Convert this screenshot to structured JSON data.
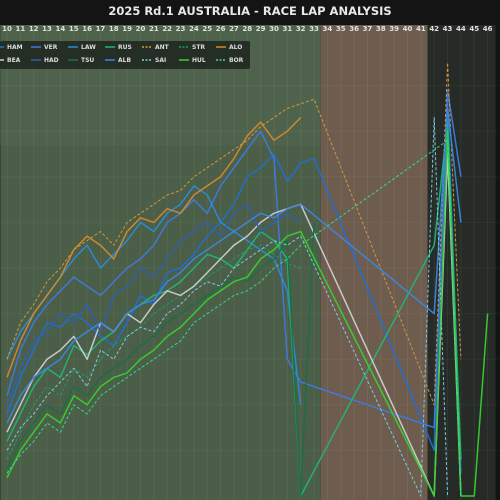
{
  "chart_data": {
    "type": "line",
    "title": "2025 Rd.1 AUSTRALIA - RACE LAP ANALYSIS",
    "xlabel": "",
    "ylabel": "",
    "x_ticks": [
      "10",
      "11",
      "12",
      "13",
      "14",
      "15",
      "16",
      "17",
      "18",
      "19",
      "20",
      "21",
      "22",
      "23",
      "24",
      "25",
      "26",
      "27",
      "28",
      "29",
      "30",
      "31",
      "32",
      "33",
      "34",
      "35",
      "36",
      "37",
      "38",
      "39",
      "40",
      "41",
      "42",
      "43",
      "44",
      "45",
      "46"
    ],
    "xlim": [
      10,
      46.6
    ],
    "ylim": [
      0,
      100
    ],
    "grid": true,
    "legend_position": "top-left",
    "phases": [
      {
        "from": 9.5,
        "to": 33.5,
        "color": "#4b5e47"
      },
      {
        "from": 33.5,
        "to": 41.5,
        "color": "#6e5d4f"
      },
      {
        "from": 41.5,
        "to": 46.6,
        "color": "#262b27"
      }
    ],
    "series": [
      {
        "name": "HAM",
        "color": "#1e6fd6",
        "dash": false,
        "x": [
          10,
          11,
          12,
          13,
          14,
          15,
          16,
          17,
          18,
          19,
          20,
          21,
          22,
          23,
          24,
          25,
          26,
          27,
          28,
          29,
          30,
          31,
          32,
          33,
          42,
          43,
          44
        ],
        "y": [
          18,
          26,
          32,
          38,
          37,
          40,
          38,
          35,
          33,
          38,
          44,
          42,
          49,
          50,
          53,
          57,
          60,
          64,
          70,
          72,
          75,
          69,
          73,
          74,
          10,
          87,
          5
        ]
      },
      {
        "name": "VER",
        "color": "#3e7ae0",
        "dash": false,
        "x": [
          10,
          11,
          12,
          13,
          14,
          15,
          16,
          17,
          18,
          19,
          20,
          21,
          22,
          23,
          24,
          25,
          26,
          27,
          28,
          29,
          30,
          31,
          32,
          42,
          43,
          44
        ],
        "y": [
          22,
          32,
          38,
          42,
          45,
          48,
          46,
          44,
          47,
          50,
          52,
          55,
          60,
          62,
          65,
          62,
          68,
          72,
          76,
          80,
          74,
          30,
          25,
          15,
          89,
          70
        ]
      },
      {
        "name": "LAW",
        "color": "#2b8cd8",
        "dash": false,
        "x": [
          10,
          11,
          12,
          13,
          14,
          15,
          16,
          17,
          18,
          19,
          20,
          21,
          22,
          23,
          24,
          25,
          26,
          27,
          28,
          29,
          30,
          31,
          32
        ],
        "y": [
          30,
          36,
          40,
          44,
          48,
          52,
          55,
          50,
          53,
          56,
          60,
          58,
          62,
          64,
          68,
          66,
          60,
          58,
          56,
          54,
          52,
          45,
          20
        ]
      },
      {
        "name": "RUS",
        "color": "#22b573",
        "dash": false,
        "x": [
          10,
          11,
          12,
          13,
          14,
          15,
          16,
          17,
          18,
          19,
          20,
          21,
          22,
          23,
          24,
          25,
          26,
          27,
          28,
          29,
          30,
          31,
          32,
          42,
          43,
          44
        ],
        "y": [
          12,
          18,
          24,
          28,
          26,
          33,
          31,
          34,
          36,
          40,
          42,
          44,
          45,
          47,
          50,
          53,
          52,
          50,
          54,
          58,
          56,
          52,
          0,
          55,
          82,
          8
        ]
      },
      {
        "name": "ANT",
        "color": "#d99a3b",
        "dash": true,
        "x": [
          10,
          11,
          12,
          13,
          14,
          15,
          16,
          17,
          18,
          19,
          20,
          21,
          22,
          23,
          24,
          25,
          26,
          27,
          28,
          29,
          30,
          31,
          32,
          33,
          42,
          43,
          44
        ],
        "y": [
          30,
          38,
          42,
          47,
          50,
          54,
          56,
          58,
          55,
          60,
          62,
          64,
          66,
          67,
          70,
          72,
          74,
          76,
          78,
          81,
          83,
          85,
          86,
          87,
          20,
          95,
          30
        ]
      },
      {
        "name": "STR",
        "color": "#1ba06b",
        "dash": true,
        "x": [
          10,
          11,
          12,
          13,
          14,
          15,
          16,
          17,
          18,
          19,
          20,
          21,
          22,
          23,
          24,
          25,
          26,
          27,
          28,
          29,
          30,
          31,
          32
        ],
        "y": [
          8,
          14,
          20,
          24,
          22,
          28,
          26,
          30,
          33,
          35,
          37,
          40,
          42,
          44,
          46,
          48,
          50,
          52,
          54,
          55,
          53,
          51,
          50
        ]
      },
      {
        "name": "ALO",
        "color": "#d48a2c",
        "dash": false,
        "x": [
          10,
          11,
          12,
          13,
          14,
          15,
          16,
          17,
          18,
          19,
          20,
          21,
          22,
          23,
          24,
          25,
          26,
          27,
          28,
          29,
          30,
          31,
          32
        ],
        "y": [
          26,
          34,
          40,
          44,
          48,
          54,
          57,
          55,
          52,
          58,
          61,
          60,
          63,
          62,
          66,
          68,
          70,
          74,
          79,
          82,
          78,
          80,
          83
        ]
      },
      {
        "name": "BEA",
        "color": "#cfcfcf",
        "dash": false,
        "x": [
          10,
          11,
          12,
          13,
          14,
          15,
          16,
          17,
          18,
          19,
          20,
          21,
          22,
          23,
          24,
          25,
          26,
          27,
          28,
          29,
          30,
          31,
          32,
          42,
          43,
          44
        ],
        "y": [
          14,
          20,
          26,
          30,
          32,
          35,
          30,
          38,
          36,
          40,
          38,
          42,
          45,
          44,
          46,
          49,
          52,
          55,
          57,
          60,
          62,
          63,
          64,
          0,
          75,
          0
        ]
      },
      {
        "name": "HAD",
        "color": "#2f5fb0",
        "dash": false,
        "x": [
          10,
          11,
          12,
          13,
          14,
          15,
          16,
          17,
          18,
          19,
          20,
          21,
          22,
          23,
          24,
          25,
          26,
          27,
          28,
          29,
          30,
          31,
          32
        ],
        "y": [
          20,
          28,
          34,
          36,
          40,
          38,
          42,
          36,
          44,
          46,
          50,
          48,
          52,
          56,
          58,
          60,
          57,
          62,
          64,
          58,
          60,
          62,
          60
        ]
      },
      {
        "name": "TSU",
        "color": "#1b6e47",
        "dash": false,
        "x": [
          10,
          11,
          12,
          13,
          14,
          15,
          16,
          17,
          18,
          19,
          20,
          21,
          22,
          23,
          24,
          25,
          26,
          27,
          28,
          29,
          30,
          31,
          32,
          33
        ],
        "y": [
          6,
          12,
          16,
          20,
          18,
          24,
          22,
          26,
          28,
          30,
          33,
          35,
          38,
          40,
          42,
          44,
          46,
          48,
          47,
          50,
          52,
          56,
          0,
          60
        ]
      },
      {
        "name": "ALB",
        "color": "#3b86e0",
        "dash": false,
        "x": [
          10,
          11,
          12,
          13,
          14,
          15,
          16,
          17,
          18,
          19,
          20,
          21,
          22,
          23,
          24,
          25,
          26,
          27,
          28,
          29,
          30,
          31,
          32,
          42,
          43,
          44
        ],
        "y": [
          16,
          22,
          26,
          28,
          30,
          34,
          36,
          38,
          36,
          40,
          42,
          43,
          47,
          49,
          52,
          54,
          56,
          58,
          60,
          62,
          61,
          63,
          64,
          40,
          85,
          60
        ]
      },
      {
        "name": "SAI",
        "color": "#7fd1e6",
        "dash": true,
        "x": [
          10,
          11,
          12,
          13,
          14,
          15,
          16,
          17,
          18,
          19,
          20,
          21,
          22,
          23,
          24,
          25,
          26,
          27,
          28,
          29,
          30,
          31,
          32,
          41,
          42,
          43
        ],
        "y": [
          10,
          15,
          18,
          22,
          25,
          28,
          24,
          32,
          30,
          35,
          37,
          36,
          40,
          42,
          45,
          47,
          46,
          50,
          52,
          54,
          56,
          55,
          57,
          0,
          83,
          0
        ]
      },
      {
        "name": "HUL",
        "color": "#36d12e",
        "dash": false,
        "x": [
          10,
          11,
          12,
          13,
          14,
          15,
          16,
          17,
          18,
          19,
          20,
          21,
          22,
          23,
          24,
          25,
          26,
          27,
          28,
          29,
          30,
          31,
          32,
          42,
          43,
          44,
          45,
          46
        ],
        "y": [
          4,
          10,
          14,
          18,
          16,
          22,
          20,
          24,
          26,
          27,
          30,
          32,
          35,
          37,
          40,
          43,
          45,
          47,
          48,
          52,
          54,
          57,
          58,
          0,
          80,
          0,
          0,
          40
        ]
      },
      {
        "name": "BOR",
        "color": "#33e08a",
        "dash": true,
        "x": [
          10,
          11,
          12,
          13,
          14,
          15,
          16,
          17,
          18,
          19,
          20,
          21,
          22,
          23,
          24,
          25,
          26,
          27,
          28,
          29,
          30,
          31,
          32,
          43,
          44
        ],
        "y": [
          5,
          9,
          12,
          16,
          14,
          20,
          18,
          22,
          24,
          26,
          28,
          30,
          32,
          34,
          38,
          40,
          42,
          44,
          45,
          47,
          50,
          52,
          55,
          78,
          0
        ]
      }
    ]
  }
}
